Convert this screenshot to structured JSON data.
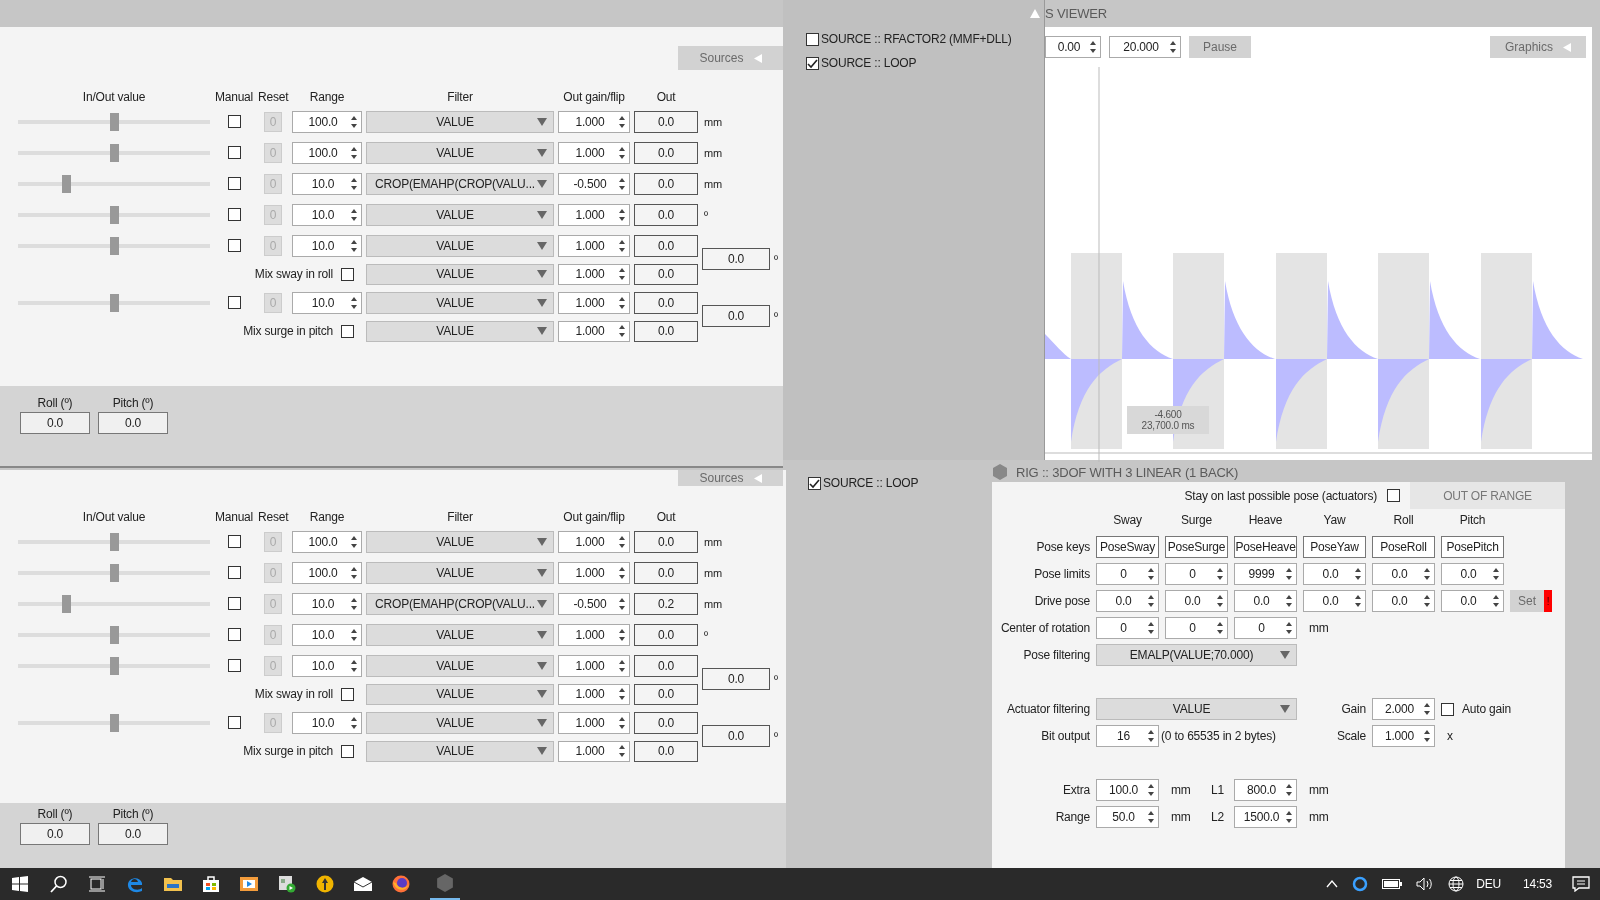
{
  "mixers": [
    {
      "sources_button": "Sources",
      "headers": [
        "In/Out value",
        "Manual",
        "Reset",
        "Range",
        "Filter",
        "Out gain/flip",
        "Out"
      ],
      "channels": [
        {
          "level": 0.5,
          "manual": false,
          "reset": "0",
          "range": "100.0",
          "filter": "VALUE",
          "gain": "1.000",
          "out": "0.0",
          "unit": "mm"
        },
        {
          "level": 0.5,
          "manual": false,
          "reset": "0",
          "range": "100.0",
          "filter": "VALUE",
          "gain": "1.000",
          "out": "0.0",
          "unit": "mm"
        },
        {
          "level": 0.25,
          "manual": false,
          "reset": "0",
          "range": "10.0",
          "filter": "CROP(EMAHP(CROP(VALU...",
          "gain": "-0.500",
          "out": "0.0",
          "unit": "mm"
        },
        {
          "level": 0.5,
          "manual": false,
          "reset": "0",
          "range": "10.0",
          "filter": "VALUE",
          "gain": "1.000",
          "out": "0.0",
          "unit": "º"
        },
        {
          "level": 0.5,
          "manual": false,
          "reset": "0",
          "range": "10.0",
          "filter": "VALUE",
          "gain": "1.000",
          "out": "0.0",
          "mix": {
            "label": "Mix sway in roll",
            "checked": false,
            "filter": "VALUE",
            "gain": "1.000",
            "out": "0.0"
          },
          "combined": {
            "value": "0.0",
            "unit": "º"
          }
        },
        {
          "level": 0.5,
          "manual": false,
          "reset": "0",
          "range": "10.0",
          "filter": "VALUE",
          "gain": "1.000",
          "out": "0.0",
          "mix": {
            "label": "Mix surge in pitch",
            "checked": false,
            "filter": "VALUE",
            "gain": "1.000",
            "out": "0.0"
          },
          "combined": {
            "value": "0.0",
            "unit": "º"
          }
        }
      ],
      "footer": [
        {
          "label": "Roll (º)",
          "value": "0.0"
        },
        {
          "label": "Pitch (º)",
          "value": "0.0"
        }
      ]
    },
    {
      "sources_button": "Sources",
      "headers": [
        "In/Out value",
        "Manual",
        "Reset",
        "Range",
        "Filter",
        "Out gain/flip",
        "Out"
      ],
      "channels": [
        {
          "level": 0.5,
          "manual": false,
          "reset": "0",
          "range": "100.0",
          "filter": "VALUE",
          "gain": "1.000",
          "out": "0.0",
          "unit": "mm"
        },
        {
          "level": 0.5,
          "manual": false,
          "reset": "0",
          "range": "100.0",
          "filter": "VALUE",
          "gain": "1.000",
          "out": "0.0",
          "unit": "mm"
        },
        {
          "level": 0.25,
          "manual": false,
          "reset": "0",
          "range": "10.0",
          "filter": "CROP(EMAHP(CROP(VALU...",
          "gain": "-0.500",
          "out": "0.2",
          "unit": "mm"
        },
        {
          "level": 0.5,
          "manual": false,
          "reset": "0",
          "range": "10.0",
          "filter": "VALUE",
          "gain": "1.000",
          "out": "0.0",
          "unit": "º"
        },
        {
          "level": 0.5,
          "manual": false,
          "reset": "0",
          "range": "10.0",
          "filter": "VALUE",
          "gain": "1.000",
          "out": "0.0",
          "mix": {
            "label": "Mix sway in roll",
            "checked": false,
            "filter": "VALUE",
            "gain": "1.000",
            "out": "0.0"
          },
          "combined": {
            "value": "0.0",
            "unit": "º"
          }
        },
        {
          "level": 0.5,
          "manual": false,
          "reset": "0",
          "range": "10.0",
          "filter": "VALUE",
          "gain": "1.000",
          "out": "0.0",
          "mix": {
            "label": "Mix surge in pitch",
            "checked": false,
            "filter": "VALUE",
            "gain": "1.000",
            "out": "0.0"
          },
          "combined": {
            "value": "0.0",
            "unit": "º"
          }
        }
      ],
      "footer": [
        {
          "label": "Roll (º)",
          "value": "0.0"
        },
        {
          "label": "Pitch (º)",
          "value": "0.0"
        }
      ]
    }
  ],
  "sources_top": [
    {
      "label": "SOURCE :: RFACTOR2 (MMF+DLL)",
      "checked": false
    },
    {
      "label": "SOURCE :: LOOP",
      "checked": true
    }
  ],
  "sources_bottom": [
    {
      "label": "SOURCE :: LOOP",
      "checked": true
    }
  ],
  "viewer": {
    "title": "S VIEWER",
    "start": "0.00",
    "span": "20.000",
    "pause_button": "Pause",
    "graphics_button": "Graphics",
    "tooltip": {
      "value": "-4.600",
      "time": "23,700.0 ms"
    }
  },
  "rig": {
    "title": "RIG :: 3DOF WITH 3 LINEAR (1 BACK)",
    "stay_label": "Stay on last possible pose (actuators)",
    "stay_checked": false,
    "out_of_range": "OUT OF RANGE",
    "axes": [
      "Sway",
      "Surge",
      "Heave",
      "Yaw",
      "Roll",
      "Pitch"
    ],
    "pose_keys": {
      "label": "Pose keys",
      "values": [
        "PoseSway",
        "PoseSurge",
        "PoseHeave",
        "PoseYaw",
        "PoseRoll",
        "PosePitch"
      ]
    },
    "pose_limits": {
      "label": "Pose limits",
      "values": [
        "0",
        "0",
        "9999",
        "0.0",
        "0.0",
        "0.0"
      ]
    },
    "drive_pose": {
      "label": "Drive pose",
      "values": [
        "0.0",
        "0.0",
        "0.0",
        "0.0",
        "0.0",
        "0.0"
      ],
      "set_button": "Set",
      "warning": "!"
    },
    "center": {
      "label": "Center of rotation",
      "values": [
        "0",
        "0",
        "0"
      ],
      "unit": "mm"
    },
    "pose_filtering": {
      "label": "Pose filtering",
      "value": "EMALP(VALUE;70.000)"
    },
    "actuator_filtering": {
      "label": "Actuator filtering",
      "value": "VALUE"
    },
    "gain": {
      "label": "Gain",
      "value": "2.000",
      "auto_label": "Auto gain",
      "auto_checked": false
    },
    "bit_output": {
      "label": "Bit output",
      "value": "16",
      "note": "(0 to 65535 in 2 bytes)"
    },
    "scale": {
      "label": "Scale",
      "value": "1.000",
      "unit": "x"
    },
    "dims": [
      {
        "label": "Extra",
        "value": "100.0",
        "unit": "mm",
        "label2": "L1",
        "value2": "800.0",
        "unit2": "mm"
      },
      {
        "label": "Range",
        "value": "50.0",
        "unit": "mm",
        "label2": "L2",
        "value2": "1500.0",
        "unit2": "mm"
      }
    ]
  },
  "taskbar": {
    "language": "DEU",
    "time": "14:53"
  }
}
